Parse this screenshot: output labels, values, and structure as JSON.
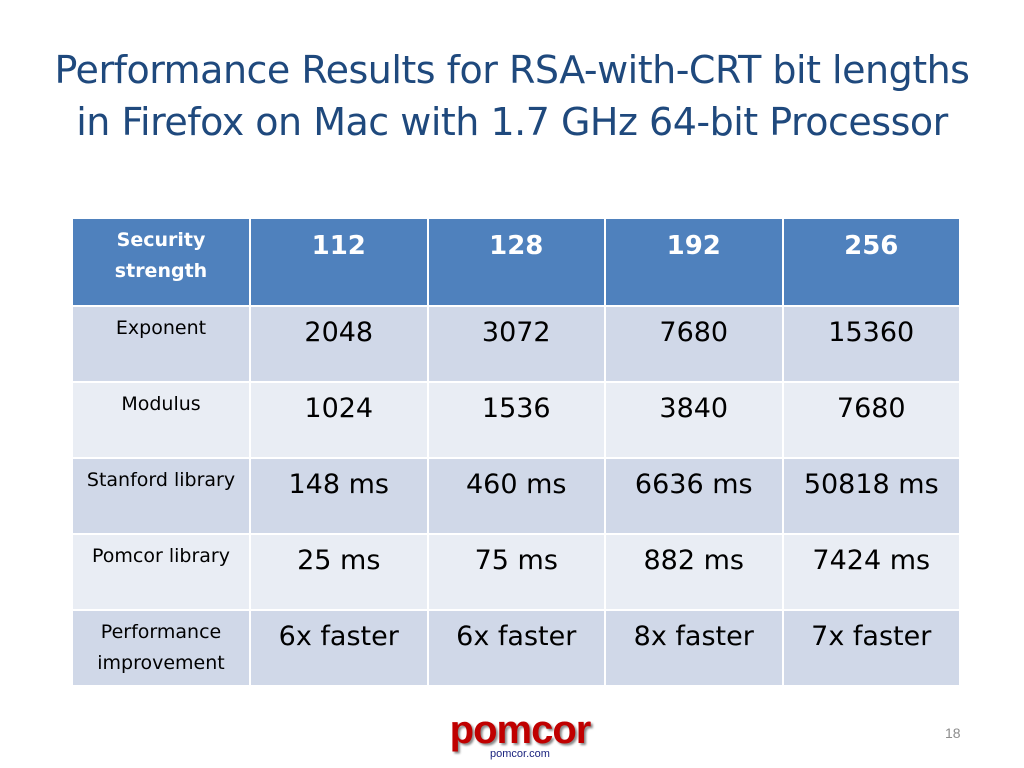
{
  "slide": {
    "title_lines": [
      "Performance Results for RSA-with-CRT bit lengths",
      "in Firefox on Mac with 1.7 GHz 64-bit Processor"
    ],
    "page_number": "18"
  },
  "table": {
    "header": {
      "label": "Security strength",
      "values": [
        "112",
        "128",
        "192",
        "256"
      ]
    },
    "rows": [
      {
        "label": "Exponent",
        "values": [
          "2048",
          "3072",
          "7680",
          "15360"
        ]
      },
      {
        "label": "Modulus",
        "values": [
          "1024",
          "1536",
          "3840",
          "7680"
        ]
      },
      {
        "label": "Stanford library",
        "values": [
          "148 ms",
          "460 ms",
          "6636 ms",
          "50818 ms"
        ]
      },
      {
        "label": "Pomcor library",
        "values": [
          "25 ms",
          "75 ms",
          "882 ms",
          "7424 ms"
        ]
      },
      {
        "label": "Performance improvement",
        "values": [
          "6x faster",
          "6x faster",
          "8x faster",
          "7x faster"
        ]
      }
    ]
  },
  "logo": {
    "name": "pomcor",
    "url_text": "pomcor.com"
  },
  "colors": {
    "title": "#1f497d",
    "header_bg": "#4f81bd",
    "row_dark": "#d0d8e8",
    "row_light": "#e9edf4",
    "logo_red": "#c00000"
  }
}
